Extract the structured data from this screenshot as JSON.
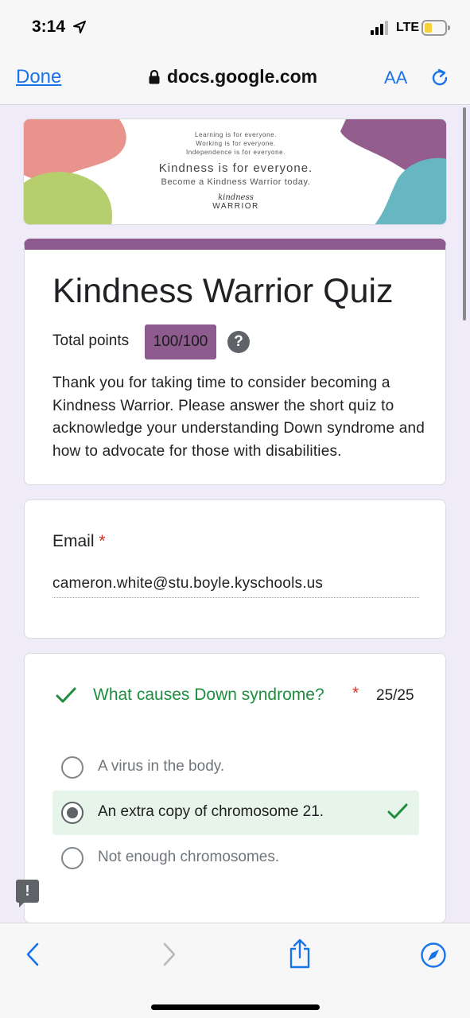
{
  "status_bar": {
    "time": "3:14",
    "network": "LTE"
  },
  "browser": {
    "done_label": "Done",
    "url": "docs.google.com",
    "text_size_label": "AA"
  },
  "banner": {
    "line1": "Learning is for everyone.",
    "line2": "Working is for everyone.",
    "line3": "Independence is for everyone.",
    "headline": "Kindness is for everyone.",
    "subline": "Become a Kindness Warrior today.",
    "logo_top": "kindness",
    "logo_bottom": "WARRIOR"
  },
  "form": {
    "title": "Kindness Warrior Quiz",
    "points_label": "Total points",
    "points_value": "100/100",
    "help_glyph": "?",
    "description": "Thank you for taking time to consider becoming a Kindness Warrior. Please answer the short quiz to acknowledge your understanding Down syndrome and how to advocate for those with disabilities."
  },
  "email": {
    "label": "Email",
    "required_mark": "*",
    "value": "cameron.white@stu.boyle.kyschools.us"
  },
  "question": {
    "text": "What causes Down syndrome?",
    "required_mark": "*",
    "score": "25/25",
    "options": [
      {
        "label": "A virus in the body.",
        "selected": false,
        "correct": false
      },
      {
        "label": "An extra copy of chromosome 21.",
        "selected": true,
        "correct": true
      },
      {
        "label": "Not enough chromosomes.",
        "selected": false,
        "correct": false
      }
    ]
  },
  "feedback_glyph": "!",
  "colors": {
    "theme": "#8e5b8f",
    "background": "#f0ebf8",
    "correct_green": "#1e8e3e",
    "link_blue": "#1a73e8",
    "required_red": "#d93025"
  },
  "icons": [
    "lock-icon",
    "reload-icon",
    "back-icon",
    "forward-icon",
    "share-icon",
    "compass-icon",
    "check-icon",
    "help-icon",
    "feedback-icon",
    "location-arrow-icon",
    "battery-icon",
    "signal-icon"
  ]
}
